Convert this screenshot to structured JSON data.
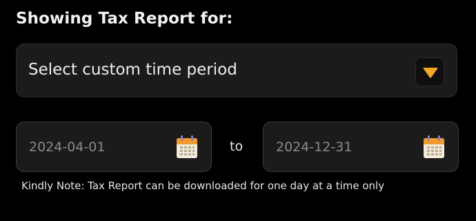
{
  "heading": "Showing Tax Report for:",
  "period_select": {
    "selected": "Select custom time period",
    "toggle_icon": "caret-down-icon",
    "toggle_color": "#f5a623"
  },
  "date_range": {
    "start_value": "2024-04-01",
    "separator": "to",
    "end_value": "2024-12-31",
    "icon": "calendar-icon"
  },
  "note": "Kindly Note: Tax Report can be downloaded for one day at a time only"
}
